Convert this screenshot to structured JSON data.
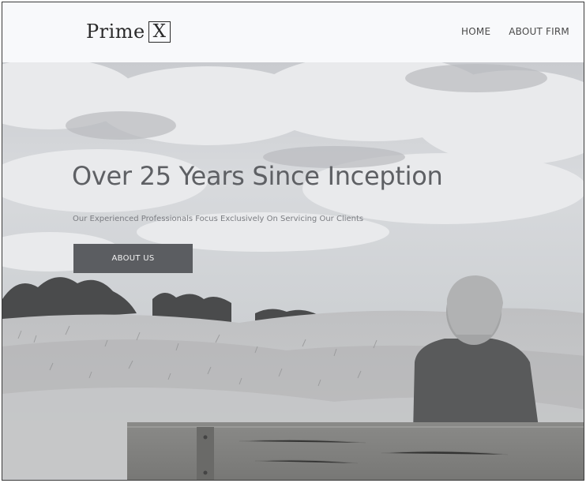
{
  "brand": {
    "name": "Prime",
    "mark": "X"
  },
  "nav": {
    "items": [
      {
        "label": "HOME"
      },
      {
        "label": "ABOUT FIRM"
      }
    ]
  },
  "hero": {
    "headline": "Over 25 Years Since Inception",
    "subheadline": "Our Experienced Professionals Focus Exclusively On Servicing Our Clients",
    "cta_label": "ABOUT US",
    "image_subject": "person seated on wooden bench facing dunes and trees under cloudy sky"
  },
  "colors": {
    "cta_background": "#5b5d61",
    "headline": "#5e6064",
    "header_background": "#f8f9fb"
  }
}
